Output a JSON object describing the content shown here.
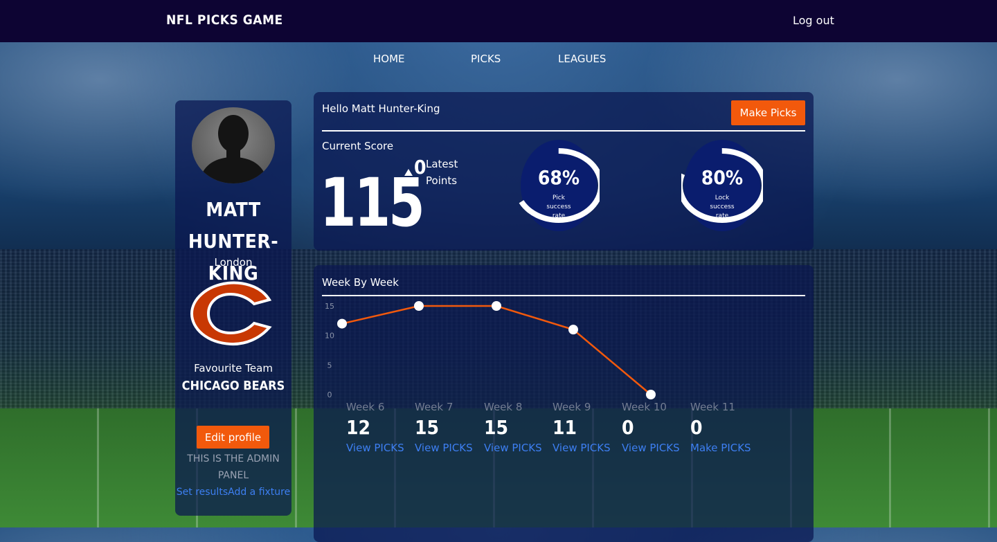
{
  "topbar": {
    "brand": "NFL PICKS GAME",
    "logout": "Log out"
  },
  "nav": [
    {
      "label": "HOME"
    },
    {
      "label": "PICKS"
    },
    {
      "label": "LEAGUES"
    }
  ],
  "profile": {
    "name_line1": "MATT",
    "name_line2": "HUNTER-KING",
    "city": "London",
    "favourite_label": "Favourite Team",
    "favourite_team": "CHICAGO BEARS",
    "edit_button": "Edit profile",
    "admin_text": "THIS IS THE ADMIN PANEL",
    "admin_link_results": "Set results",
    "admin_link_fixture": "Add a fixture"
  },
  "score": {
    "greeting": "Hello Matt Hunter-King",
    "make_picks_button": "Make Picks",
    "current_label": "Current Score",
    "current_value": "115",
    "latest_value": "0",
    "latest_label": "Latest Points",
    "gauges": [
      {
        "value": 68,
        "display": "68%",
        "caption": "Pick success rate"
      },
      {
        "value": 80,
        "display": "80%",
        "caption": "Lock success rate"
      }
    ],
    "colors": {
      "gauge_fill": "#0a1d6e",
      "gauge_ring": "#ffffff",
      "accent": "#f2590c"
    }
  },
  "weekly": {
    "title": "Week By Week",
    "chart_data": {
      "type": "line",
      "x": [
        "Week 6",
        "Week 7",
        "Week 8",
        "Week 9",
        "Week 10"
      ],
      "series": [
        {
          "values": [
            12,
            15,
            15,
            11,
            0
          ]
        }
      ],
      "ylim": [
        0,
        15
      ],
      "yticks": [
        "0",
        "5",
        "10",
        "15"
      ],
      "line_color": "#f2590c"
    },
    "weeks": [
      {
        "name": "Week 6",
        "points": "12",
        "link": "View PICKS"
      },
      {
        "name": "Week 7",
        "points": "15",
        "link": "View PICKS"
      },
      {
        "name": "Week 8",
        "points": "15",
        "link": "View PICKS"
      },
      {
        "name": "Week 9",
        "points": "11",
        "link": "View PICKS"
      },
      {
        "name": "Week 10",
        "points": "0",
        "link": "View PICKS"
      },
      {
        "name": "Week 11",
        "points": "0",
        "link": "Make PICKS"
      }
    ]
  }
}
